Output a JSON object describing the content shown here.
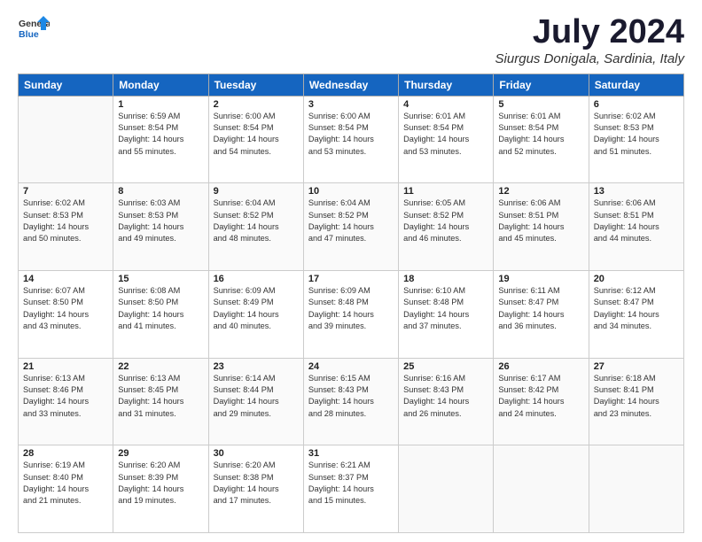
{
  "header": {
    "logo": {
      "general": "General",
      "blue": "Blue"
    },
    "title": "July 2024",
    "location": "Siurgus Donigala, Sardinia, Italy"
  },
  "weekdays": [
    "Sunday",
    "Monday",
    "Tuesday",
    "Wednesday",
    "Thursday",
    "Friday",
    "Saturday"
  ],
  "weeks": [
    [
      {
        "day": null
      },
      {
        "day": 1,
        "sunrise": "6:59 AM",
        "sunset": "8:54 PM",
        "daylight": "14 hours and 55 minutes."
      },
      {
        "day": 2,
        "sunrise": "6:00 AM",
        "sunset": "8:54 PM",
        "daylight": "14 hours and 54 minutes."
      },
      {
        "day": 3,
        "sunrise": "6:00 AM",
        "sunset": "8:54 PM",
        "daylight": "14 hours and 53 minutes."
      },
      {
        "day": 4,
        "sunrise": "6:01 AM",
        "sunset": "8:54 PM",
        "daylight": "14 hours and 53 minutes."
      },
      {
        "day": 5,
        "sunrise": "6:01 AM",
        "sunset": "8:54 PM",
        "daylight": "14 hours and 52 minutes."
      },
      {
        "day": 6,
        "sunrise": "6:02 AM",
        "sunset": "8:53 PM",
        "daylight": "14 hours and 51 minutes."
      }
    ],
    [
      {
        "day": 7,
        "sunrise": "6:02 AM",
        "sunset": "8:53 PM",
        "daylight": "14 hours and 50 minutes."
      },
      {
        "day": 8,
        "sunrise": "6:03 AM",
        "sunset": "8:53 PM",
        "daylight": "14 hours and 49 minutes."
      },
      {
        "day": 9,
        "sunrise": "6:04 AM",
        "sunset": "8:52 PM",
        "daylight": "14 hours and 48 minutes."
      },
      {
        "day": 10,
        "sunrise": "6:04 AM",
        "sunset": "8:52 PM",
        "daylight": "14 hours and 47 minutes."
      },
      {
        "day": 11,
        "sunrise": "6:05 AM",
        "sunset": "8:52 PM",
        "daylight": "14 hours and 46 minutes."
      },
      {
        "day": 12,
        "sunrise": "6:06 AM",
        "sunset": "8:51 PM",
        "daylight": "14 hours and 45 minutes."
      },
      {
        "day": 13,
        "sunrise": "6:06 AM",
        "sunset": "8:51 PM",
        "daylight": "14 hours and 44 minutes."
      }
    ],
    [
      {
        "day": 14,
        "sunrise": "6:07 AM",
        "sunset": "8:50 PM",
        "daylight": "14 hours and 43 minutes."
      },
      {
        "day": 15,
        "sunrise": "6:08 AM",
        "sunset": "8:50 PM",
        "daylight": "14 hours and 41 minutes."
      },
      {
        "day": 16,
        "sunrise": "6:09 AM",
        "sunset": "8:49 PM",
        "daylight": "14 hours and 40 minutes."
      },
      {
        "day": 17,
        "sunrise": "6:09 AM",
        "sunset": "8:48 PM",
        "daylight": "14 hours and 39 minutes."
      },
      {
        "day": 18,
        "sunrise": "6:10 AM",
        "sunset": "8:48 PM",
        "daylight": "14 hours and 37 minutes."
      },
      {
        "day": 19,
        "sunrise": "6:11 AM",
        "sunset": "8:47 PM",
        "daylight": "14 hours and 36 minutes."
      },
      {
        "day": 20,
        "sunrise": "6:12 AM",
        "sunset": "8:47 PM",
        "daylight": "14 hours and 34 minutes."
      }
    ],
    [
      {
        "day": 21,
        "sunrise": "6:13 AM",
        "sunset": "8:46 PM",
        "daylight": "14 hours and 33 minutes."
      },
      {
        "day": 22,
        "sunrise": "6:13 AM",
        "sunset": "8:45 PM",
        "daylight": "14 hours and 31 minutes."
      },
      {
        "day": 23,
        "sunrise": "6:14 AM",
        "sunset": "8:44 PM",
        "daylight": "14 hours and 29 minutes."
      },
      {
        "day": 24,
        "sunrise": "6:15 AM",
        "sunset": "8:43 PM",
        "daylight": "14 hours and 28 minutes."
      },
      {
        "day": 25,
        "sunrise": "6:16 AM",
        "sunset": "8:43 PM",
        "daylight": "14 hours and 26 minutes."
      },
      {
        "day": 26,
        "sunrise": "6:17 AM",
        "sunset": "8:42 PM",
        "daylight": "14 hours and 24 minutes."
      },
      {
        "day": 27,
        "sunrise": "6:18 AM",
        "sunset": "8:41 PM",
        "daylight": "14 hours and 23 minutes."
      }
    ],
    [
      {
        "day": 28,
        "sunrise": "6:19 AM",
        "sunset": "8:40 PM",
        "daylight": "14 hours and 21 minutes."
      },
      {
        "day": 29,
        "sunrise": "6:20 AM",
        "sunset": "8:39 PM",
        "daylight": "14 hours and 19 minutes."
      },
      {
        "day": 30,
        "sunrise": "6:20 AM",
        "sunset": "8:38 PM",
        "daylight": "14 hours and 17 minutes."
      },
      {
        "day": 31,
        "sunrise": "6:21 AM",
        "sunset": "8:37 PM",
        "daylight": "14 hours and 15 minutes."
      },
      {
        "day": null
      },
      {
        "day": null
      },
      {
        "day": null
      }
    ]
  ]
}
